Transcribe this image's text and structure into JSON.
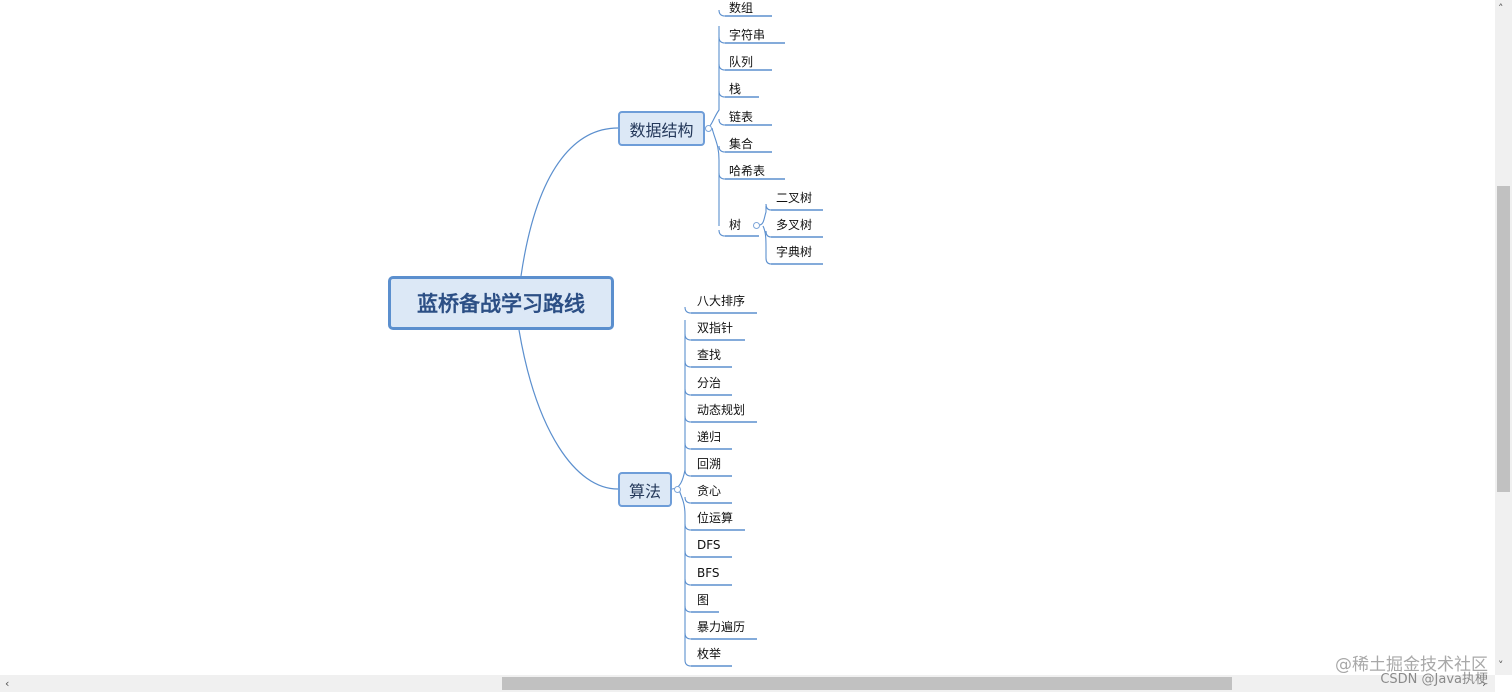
{
  "root": "蓝桥备战学习路线",
  "branches": [
    {
      "label": "数据结构",
      "leaves": [
        "数组",
        "字符串",
        "队列",
        "栈",
        "链表",
        "集合",
        "哈希表"
      ],
      "subbranch": {
        "label": "树",
        "leaves": [
          "二叉树",
          "多叉树",
          "字典树"
        ]
      }
    },
    {
      "label": "算法",
      "leaves": [
        "八大排序",
        "双指针",
        "查找",
        "分治",
        "动态规划",
        "递归",
        "回溯",
        "贪心",
        "位运算",
        "DFS",
        "BFS",
        "图",
        "暴力遍历",
        "枚举"
      ]
    }
  ],
  "colors": {
    "line": "#5b8fce",
    "box_fill": "#dce8f6",
    "root_border": "#5b8fce"
  },
  "watermark": {
    "line1": "@稀土掘金技术社区",
    "line2": "CSDN @Java执梗"
  },
  "scroll": {
    "up": "˄",
    "down": "˅",
    "left": "‹",
    "right": "›"
  }
}
